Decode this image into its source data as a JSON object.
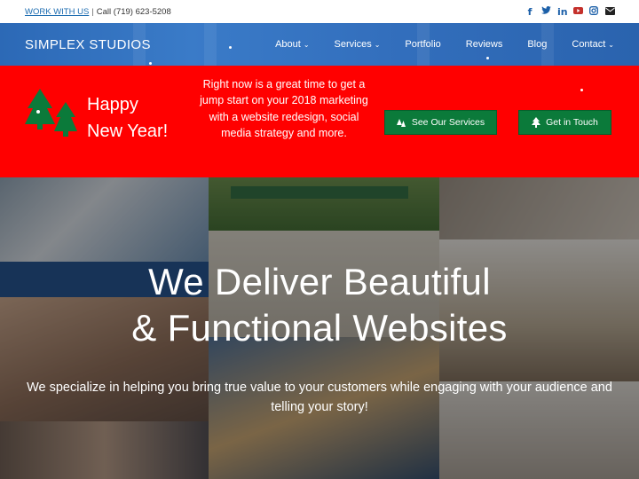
{
  "topbar": {
    "work_link": "WORK WITH US",
    "separator": "|",
    "phone": "Call (719) 623-5208",
    "social_icons": [
      "facebook-icon",
      "twitter-icon",
      "linkedin-icon",
      "youtube-icon",
      "instagram-icon",
      "email-icon"
    ]
  },
  "nav": {
    "brand": "SIMPLEX STUDIOS",
    "items": [
      {
        "label": "About",
        "dropdown": true
      },
      {
        "label": "Services",
        "dropdown": true
      },
      {
        "label": "Portfolio",
        "dropdown": false
      },
      {
        "label": "Reviews",
        "dropdown": false
      },
      {
        "label": "Blog",
        "dropdown": false
      },
      {
        "label": "Contact",
        "dropdown": true
      }
    ]
  },
  "banner": {
    "greeting_line1": "Happy",
    "greeting_line2": "New Year!",
    "promo": "Right now is a great time to get a jump start on your 2018 marketing with a website redesign, social media strategy and more.",
    "button1_label": "See Our Services",
    "button2_label": "Get in Touch"
  },
  "hero": {
    "headline_line1": "We Deliver Beautiful",
    "headline_line2": "& Functional Websites",
    "subheadline": "We specialize in helping you bring true value to your customers while engaging with your audience and telling your story!"
  },
  "colors": {
    "nav_blue": "#2f6db9",
    "banner_red": "#ff0000",
    "button_green": "#0b7a3a",
    "link_blue": "#1b6bb0"
  }
}
